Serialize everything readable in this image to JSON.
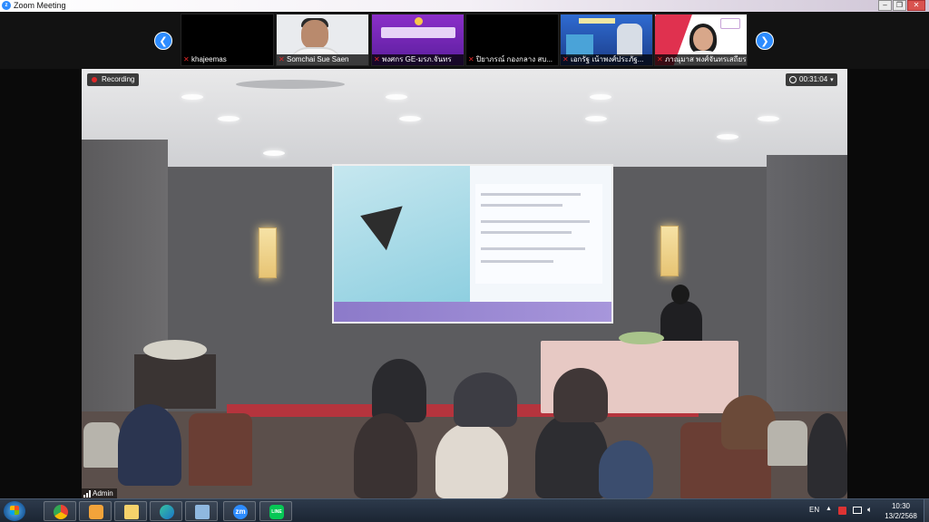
{
  "window": {
    "title": "Zoom Meeting",
    "controls": [
      "–",
      "❐",
      "✕"
    ]
  },
  "strip": {
    "prev_label": "❮",
    "next_label": "❯",
    "participants": [
      {
        "name": "khajeemas"
      },
      {
        "name": "Somchai Sue Saen"
      },
      {
        "name": "พงศกร GE-มรภ.จันทร"
      },
      {
        "name": "ปิยาภรณ์ กองกลาง สบ..."
      },
      {
        "name": "เอกรัฐ เน้าพงศ์ประภัฐ..."
      },
      {
        "name": "ภาณุมาส พงศ์จันทรเสถียร"
      }
    ]
  },
  "video": {
    "recording_label": "Recording",
    "timer": "00:31:04",
    "speaker_label": "Admin"
  },
  "taskbar": {
    "language": "EN",
    "time": "10:30",
    "date": "13/2/2568",
    "apps": [
      "start",
      "chrome",
      "media-player",
      "file-explorer",
      "edge",
      "snipping-tool",
      "zoom",
      "line"
    ],
    "zoom_label": "zm",
    "line_label": "LINE"
  },
  "colors": {
    "zoom_blue": "#2d8cff",
    "muted_red": "#e02828",
    "line_green": "#06c755"
  }
}
